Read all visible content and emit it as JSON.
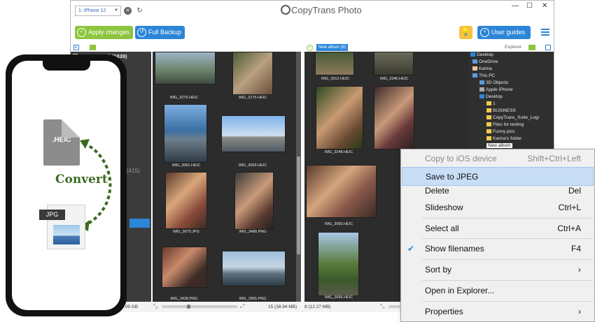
{
  "app": {
    "device_select": "1: iPhone 12",
    "logo": "CopyTrans Photo",
    "toolbar": {
      "apply": "Apply changes",
      "backup": "Full Backup",
      "guides": "User guides"
    },
    "left": {
      "camera_roll": "Camera Roll (1839)",
      "count": "(415)",
      "status": "Free: 67.77 GB Total: 119.09 GB",
      "count_status": "15 (38.94 MB)"
    },
    "captions_left": [
      "IMG_3276.HEIC",
      "IMG_3175.HEIC",
      "IMG_3061.HEIC",
      "IMG_3003.HEIC",
      "IMG_3073.JPG",
      "IMG_3480.PNG",
      "IMG_3438.PNG",
      "IMG_2855.PNG"
    ],
    "right": {
      "album_tag": "New album (8)",
      "explorer": "Explorer",
      "status": "8 (12.27 MB)"
    },
    "captions_right": [
      "IMG_3912.HEIC",
      "IMG_3346.HEIC",
      "IMG_3248.HEIC",
      "IMG_3069.HEIC",
      "IMG_2696.HEIC"
    ],
    "tree": [
      "Desktop",
      "OneDrive",
      "Karina",
      "This PC",
      "3D Objects",
      "Apple iPhone",
      "Desktop",
      "1",
      "BUSINESS",
      "CopyTrans_Suite_Logi",
      "Files for testing",
      "Funny pics",
      "Karina's folder",
      "New album"
    ]
  },
  "phone": {
    "heic": ".HEIC",
    "convert": "Convert",
    "jpg": "JPG"
  },
  "menu": [
    {
      "label": "Copy to iOS device",
      "shortcut": "Shift+Ctrl+Left"
    },
    {
      "label": "Save to JPEG",
      "shortcut": ""
    },
    {
      "label": "Delete",
      "shortcut": "Del"
    },
    {
      "label": "Slideshow",
      "shortcut": "Ctrl+L"
    },
    {
      "label": "Select all",
      "shortcut": "Ctrl+A"
    },
    {
      "label": "Show filenames",
      "shortcut": "F4"
    },
    {
      "label": "Sort by",
      "shortcut": "›"
    },
    {
      "label": "Open in Explorer...",
      "shortcut": ""
    },
    {
      "label": "Properties",
      "shortcut": "›"
    }
  ],
  "colors": {
    "accent": "#2b86d8",
    "green": "#8dc53e",
    "dark_panel": "#2c2c2c",
    "menu_bg": "#f0f0f0",
    "highlight": "#c8ddf6"
  }
}
